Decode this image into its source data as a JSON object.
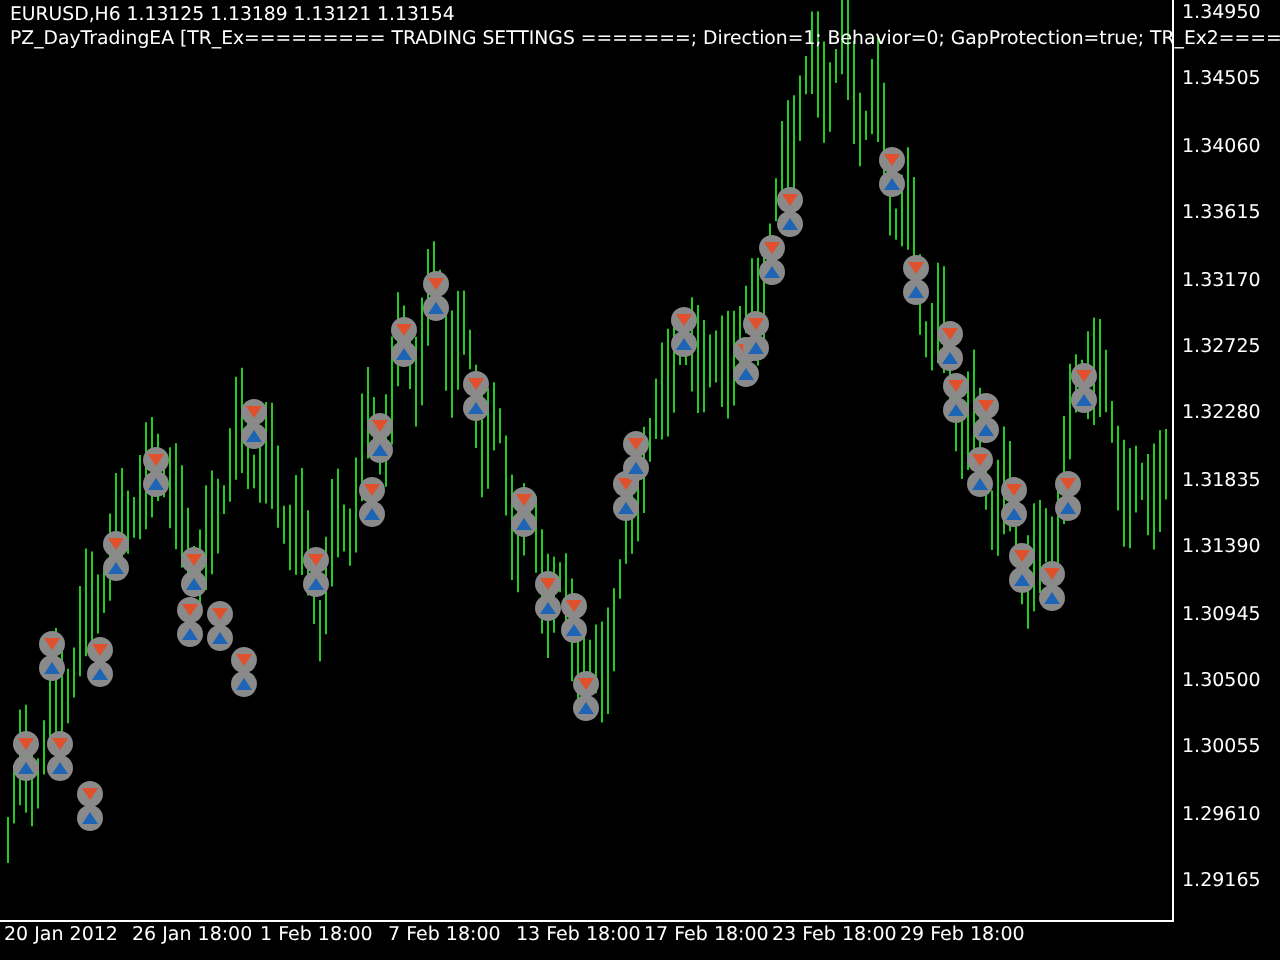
{
  "chart": {
    "header": "EURUSD,H6  1.13125 1.13189 1.13121 1.13154",
    "indicator_line": "PZ_DayTradingEA [TR_Ex========= TRADING SETTINGS =======; Direction=1; Behavior=0; GapProtection=true; TR_Ex2====",
    "price_axis": [
      "1.34950",
      "1.34505",
      "1.34060",
      "1.33615",
      "1.33170",
      "1.32725",
      "1.32280",
      "1.31835",
      "1.31390",
      "1.30945",
      "1.30500",
      "1.30055",
      "1.29610",
      "1.29165"
    ],
    "time_axis": [
      "20 Jan 2012",
      "26 Jan 18:00",
      "1 Feb 18:00",
      "7 Feb 18:00",
      "13 Feb 18:00",
      "17 Feb 18:00",
      "23 Feb 18:00",
      "29 Feb 18:00"
    ]
  }
}
